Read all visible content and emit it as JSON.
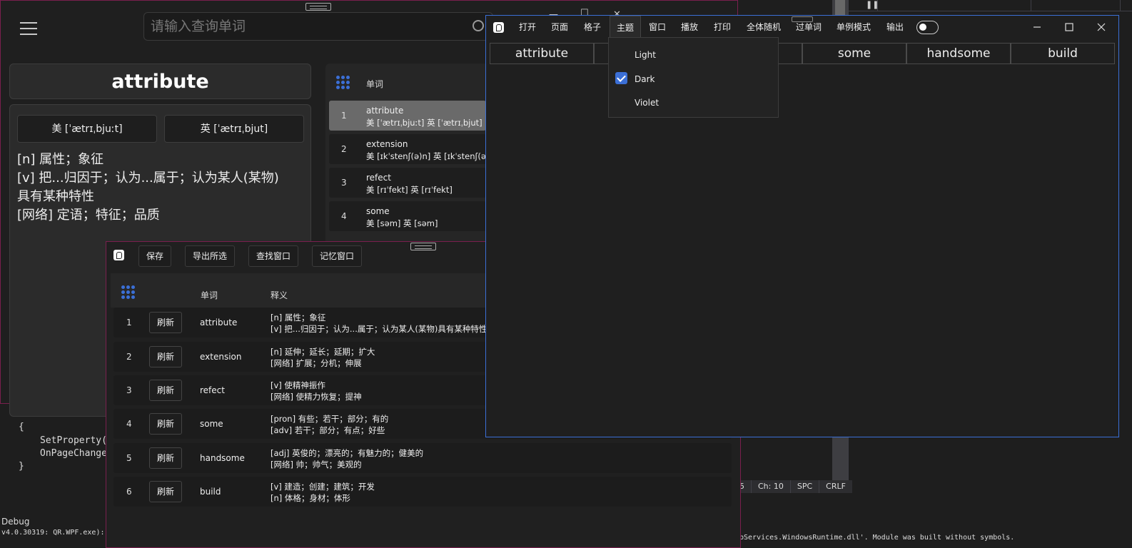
{
  "ide": {
    "code_lines": [
      "{",
      "SetProperty(",
      "OnPageChange",
      "}"
    ],
    "status": [
      "5",
      "Ch: 10",
      "SPC",
      "CRLF"
    ],
    "debug_label": "Debug",
    "debug_text": "v4.0.30319: QR.WPF.exe):",
    "debug_text_right": "pServices.WindowsRuntime.dll'. Module was built without symbols."
  },
  "query_window": {
    "search_placeholder": "请输入查询单词",
    "title": "attribute",
    "phonetic_us": "美 [ˈætrɪˌbjuːt]",
    "phonetic_uk": "英 [ˈætrɪˌbjut]",
    "definitions": [
      "[n] 属性；象征",
      "[v] 把...归因于；认为...属于；认为某人(某物)",
      "具有某种特性",
      "[网络] 定语；特征；品质"
    ],
    "list_header": "单词",
    "list": [
      {
        "idx": "1",
        "word": "attribute",
        "phon": "美 [ˈætrɪˌbjuːt] 英 [ˈætrɪˌbjut]"
      },
      {
        "idx": "2",
        "word": "extension",
        "phon": "美 [ɪkˈstenʃ(ə)n] 英 [ɪkˈstenʃ(ə)n]"
      },
      {
        "idx": "3",
        "word": "refect",
        "phon": "美 [rɪˈfekt] 英 [rɪˈfekt]"
      },
      {
        "idx": "4",
        "word": "some",
        "phon": "美 [səm] 英 [səm]"
      }
    ]
  },
  "dict_window": {
    "toolbar": [
      "保存",
      "导出所选",
      "查找窗口",
      "记忆窗口"
    ],
    "col_word": "单词",
    "col_meaning": "释义",
    "refresh_label": "刷新",
    "rows": [
      {
        "idx": "1",
        "word": "attribute",
        "m1": "[n] 属性；象征",
        "m2": "[v] 把...归因于；认为...属于；认为某人(某物)具有某种特性"
      },
      {
        "idx": "2",
        "word": "extension",
        "m1": "[n] 延伸；延长；延期；扩大",
        "m2": "[网络] 扩展；分机；伸展"
      },
      {
        "idx": "3",
        "word": "refect",
        "m1": "[v] 使精神振作",
        "m2": "[网络] 使精力恢复；提神"
      },
      {
        "idx": "4",
        "word": "some",
        "m1": "[pron] 有些；若干；部分；有的",
        "m2": "[adv] 若干；部分；有点；好些"
      },
      {
        "idx": "5",
        "word": "handsome",
        "m1": "[adj] 英俊的；漂亮的；有魅力的；健美的",
        "m2": "[网络] 帅；帅气；美观的"
      },
      {
        "idx": "6",
        "word": "build",
        "m1": "[v] 建造；创建；建筑；开发",
        "m2": "[n] 体格；身材；体形"
      }
    ]
  },
  "grid_window": {
    "menu": [
      "打开",
      "页面",
      "格子",
      "主题",
      "窗口",
      "播放",
      "打印",
      "全体随机",
      "过单词",
      "单例模式",
      "输出"
    ],
    "active_menu": "主题",
    "cells": [
      "attribute",
      "",
      "",
      "some",
      "handsome",
      "build"
    ],
    "theme_options": [
      "Light",
      "Dark",
      "Violet"
    ],
    "theme_selected": "Dark",
    "output_toggle": "off"
  },
  "colors": {
    "accent": "#3b6fd6",
    "window_border": "#7a1f4e",
    "bg": "#1e1e1e"
  }
}
